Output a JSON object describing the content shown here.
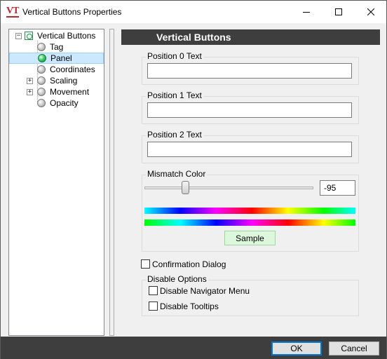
{
  "window": {
    "title": "Vertical Buttons Properties",
    "app_icon_text": "VT"
  },
  "tree": {
    "root": "Vertical Buttons",
    "items": [
      {
        "label": "Tag",
        "expandable": false
      },
      {
        "label": "Panel",
        "expandable": false,
        "selected": true
      },
      {
        "label": "Coordinates",
        "expandable": false
      },
      {
        "label": "Scaling",
        "expandable": true
      },
      {
        "label": "Movement",
        "expandable": true
      },
      {
        "label": "Opacity",
        "expandable": false
      }
    ]
  },
  "panel": {
    "header": "Vertical Buttons",
    "position0": {
      "label": "Position 0 Text",
      "value": ""
    },
    "position1": {
      "label": "Position 1 Text",
      "value": ""
    },
    "position2": {
      "label": "Position 2 Text",
      "value": ""
    },
    "mismatch": {
      "label": "Mismatch Color",
      "value": "-95",
      "sample_label": "Sample"
    },
    "confirmation": {
      "label": "Confirmation Dialog",
      "checked": false
    },
    "disable_options": {
      "label": "Disable Options",
      "navigator": {
        "label": "Disable Navigator Menu",
        "checked": false
      },
      "tooltips": {
        "label": "Disable Tooltips",
        "checked": false
      }
    }
  },
  "footer": {
    "ok_label": "OK",
    "cancel_label": "Cancel"
  },
  "colors": {
    "header_bg": "#3e3e3e",
    "selection": "#cce8ff",
    "sample_bg": "#ddf7dd",
    "ok_border": "#0078d7"
  }
}
